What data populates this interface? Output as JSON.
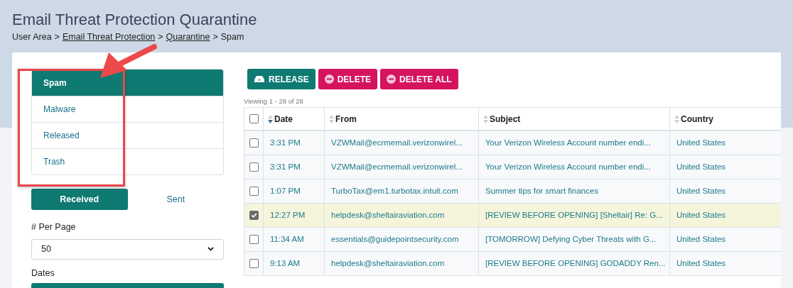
{
  "page": {
    "title": "Email Threat Protection Quarantine"
  },
  "breadcrumb": [
    {
      "label": "User Area",
      "link": false
    },
    {
      "label": "Email Threat Protection",
      "link": true
    },
    {
      "label": "Quarantine",
      "link": true
    },
    {
      "label": "Spam",
      "link": false
    }
  ],
  "breadcrumb_separator": ">",
  "folders": [
    {
      "label": "Spam",
      "selected": true
    },
    {
      "label": "Malware",
      "selected": false
    },
    {
      "label": "Released",
      "selected": false
    },
    {
      "label": "Trash",
      "selected": false
    }
  ],
  "direction_toggle": [
    {
      "label": "Received",
      "selected": true
    },
    {
      "label": "Sent",
      "selected": false
    }
  ],
  "per_page": {
    "label": "# Per Page",
    "value": "50"
  },
  "dates": {
    "label": "Dates"
  },
  "actions": [
    {
      "label": "RELEASE",
      "kind": "release"
    },
    {
      "label": "DELETE",
      "kind": "delete"
    },
    {
      "label": "DELETE ALL",
      "kind": "delete"
    }
  ],
  "viewing": "Viewing 1 - 28 of 28",
  "table": {
    "select_all": {
      "checked": false
    },
    "columns": [
      {
        "label": "Date",
        "sorted": true
      },
      {
        "label": "From",
        "sorted": false
      },
      {
        "label": "Subject",
        "sorted": false
      },
      {
        "label": "Country",
        "sorted": false
      }
    ],
    "rows": [
      {
        "selected": false,
        "cells": [
          "3:31 PM",
          "VZWMail@ecrmemail.verizonwirel...",
          "Your Verizon Wireless Account number endi...",
          "United States"
        ]
      },
      {
        "selected": false,
        "cells": [
          "3:31 PM",
          "VZWMail@ecrmemail.verizonwirel...",
          "Your Verizon Wireless Account number endi...",
          "United States"
        ]
      },
      {
        "selected": false,
        "cells": [
          "1:07 PM",
          "TurboTax@em1.turbotax.intuit.com",
          "Summer tips for smart finances",
          "United States"
        ]
      },
      {
        "selected": true,
        "cells": [
          "12:27 PM",
          "helpdesk@sheltairaviation.com",
          "[REVIEW BEFORE OPENING] [Sheltair] Re: G...",
          "United States"
        ]
      },
      {
        "selected": false,
        "cells": [
          "11:34 AM",
          "essentials@guidepointsecurity.com",
          "[TOMORROW] Defying Cyber Threats with G...",
          "United States"
        ]
      },
      {
        "selected": false,
        "cells": [
          "9:13 AM",
          "helpdesk@sheltairaviation.com",
          "[REVIEW BEFORE OPENING] GODADDY Ren...",
          "United States"
        ]
      }
    ]
  },
  "annotation": {
    "highlight": true,
    "arrow": true
  }
}
